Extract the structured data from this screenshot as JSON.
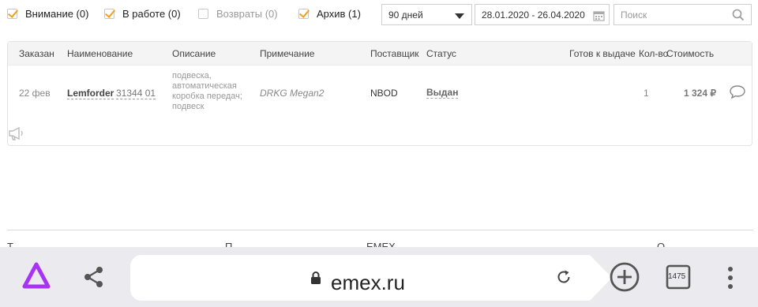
{
  "filters": {
    "checkboxes": [
      {
        "label": "Внимание (0)",
        "checked": true
      },
      {
        "label": "В работе (0)",
        "checked": true
      },
      {
        "label": "Возвраты (0)",
        "checked": false
      },
      {
        "label": "Архив (1)",
        "checked": true
      }
    ],
    "period_select": "90 дней",
    "date_range": "28.01.2020 - 26.04.2020",
    "search_placeholder": "Поиск"
  },
  "table": {
    "headers": [
      "Заказан",
      "Наименование",
      "Описание",
      "Примечание",
      "Поставщик",
      "Статус",
      "Готов к выдаче",
      "Кол-во",
      "Стоимость"
    ],
    "row": {
      "date": "22 фев",
      "brand": "Lemforder",
      "article": "31344 01",
      "description": "подвеска, автоматическая коробка передач; подвеск",
      "note": "DRKG Megan2",
      "supplier": "NBOD",
      "status": "Выдан",
      "ready": "",
      "quantity": "1",
      "price": "1 324 ₽"
    }
  },
  "footer_cutoff": [
    "Т",
    "П",
    "EMEX",
    "О"
  ],
  "browser": {
    "url": "emex.ru",
    "tab_count": "1475",
    "icons": [
      "alice-icon",
      "share-icon",
      "lock-icon",
      "reload-icon",
      "new-tab-icon",
      "tabs-icon",
      "menu-icon"
    ]
  },
  "colors": {
    "checkbox_accent": "#f0a020",
    "browser_bar": "#eaeaef",
    "alice_brand": "#a833f5"
  }
}
